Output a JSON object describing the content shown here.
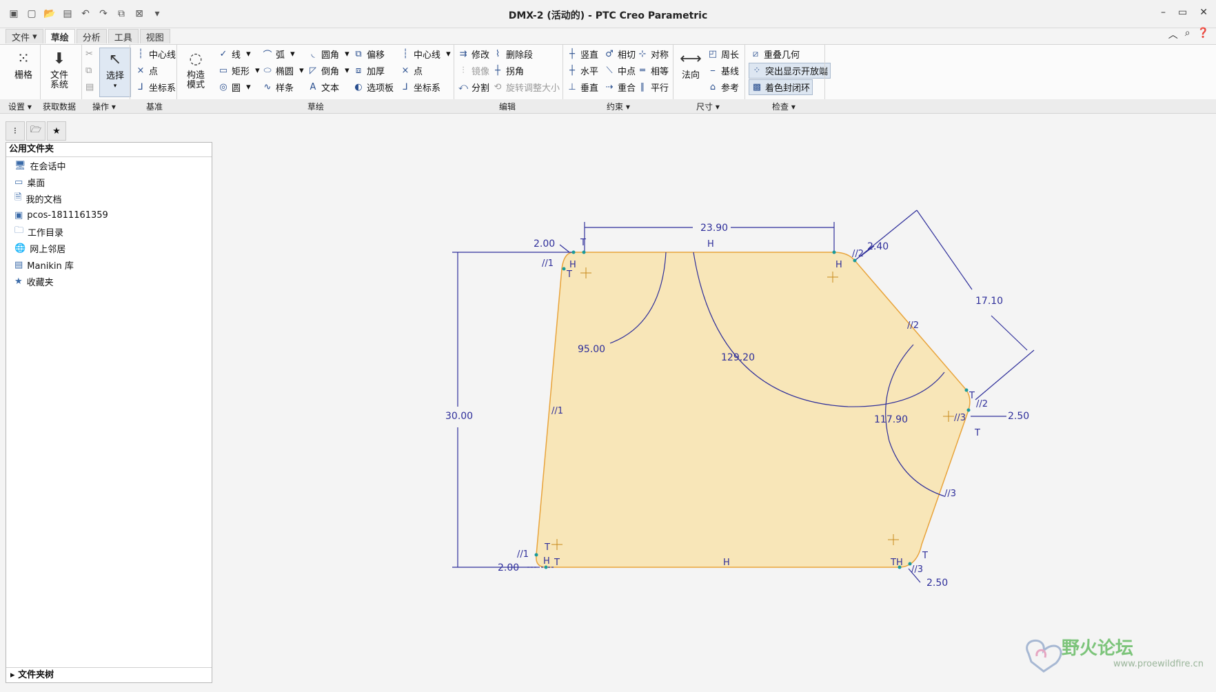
{
  "window": {
    "title": "DMX-2 (活动的) - PTC Creo Parametric"
  },
  "tabs": [
    {
      "label": "文件"
    },
    {
      "label": "草绘"
    },
    {
      "label": "分析"
    },
    {
      "label": "工具"
    },
    {
      "label": "视图"
    }
  ],
  "ribbon": {
    "settings": {
      "grid": "栅格"
    },
    "getdata": {
      "filesystem": "文件系统"
    },
    "operations": {
      "select": "选择"
    },
    "datum": {
      "centerline": "中心线",
      "point": "点",
      "coordsys": "坐标系"
    },
    "construct": {
      "mode": "构造模式"
    },
    "sketch": {
      "line": "线",
      "arc": "弧",
      "fillet": "圆角",
      "offset": "偏移",
      "rectangle": "矩形",
      "ellipse": "椭圆",
      "chamfer": "倒角",
      "thicken": "加厚",
      "circle": "圆",
      "spline": "样条",
      "text": "文本",
      "palette": "选项板",
      "centerline": "中心线",
      "point": "点",
      "coordsys": "坐标系"
    },
    "edit": {
      "modify": "修改",
      "delete_segment": "删除段",
      "mirror": "镜像",
      "corner": "拐角",
      "divide": "分割",
      "rotate_resize": "旋转调整大小"
    },
    "constrain": {
      "vertical": "竖直",
      "tangent": "相切",
      "symmetric": "对称",
      "horizontal": "水平",
      "midpoint": "中点",
      "equal": "相等",
      "perpendicular": "垂直",
      "coincident": "重合",
      "parallel": "平行"
    },
    "dimension": {
      "normal": "法向",
      "perimeter": "周长",
      "baseline": "基线",
      "reference": "参考"
    },
    "inspect": {
      "overlap": "重叠几何",
      "highlight_open": "突出显示开放端",
      "shade_closed": "着色封闭环"
    }
  },
  "group_labels": [
    "设置",
    "获取数据",
    "操作",
    "基准",
    "草绘",
    "编辑",
    "约束",
    "尺寸",
    "检查"
  ],
  "navigator": {
    "header": "公用文件夹",
    "items": [
      {
        "label": "在会话中",
        "icon": "monitor-icon"
      },
      {
        "label": "桌面",
        "icon": "desktop-icon"
      },
      {
        "label": "我的文档",
        "icon": "documents-icon"
      },
      {
        "label": "pcos-1811161359",
        "icon": "computer-icon"
      },
      {
        "label": "工作目录",
        "icon": "folder-icon"
      },
      {
        "label": "网上邻居",
        "icon": "network-icon"
      },
      {
        "label": "Manikin 库",
        "icon": "library-icon"
      },
      {
        "label": "收藏夹",
        "icon": "favorites-icon"
      }
    ],
    "footer": "文件夹树"
  },
  "dims": {
    "top": "23.90",
    "left_fillet": "2.00",
    "right_top": "2.40",
    "slant": "17.10",
    "angle1": "95.00",
    "angle2": "129.20",
    "angle3": "117.90",
    "height": "30.00",
    "right_mid": "2.50",
    "bottom_left": "2.00",
    "bottom_right": "2.50"
  },
  "constraints": {
    "h": "H",
    "t": "T",
    "p1": "//1",
    "p2": "//2",
    "p3": "//3",
    "th": "TH"
  },
  "watermark": {
    "text": "野火论坛",
    "url": "www.proewildfire.cn"
  },
  "colors": {
    "fill": "#f8e6b8",
    "edge": "#e8a33a",
    "dim": "#2e2e9a"
  }
}
